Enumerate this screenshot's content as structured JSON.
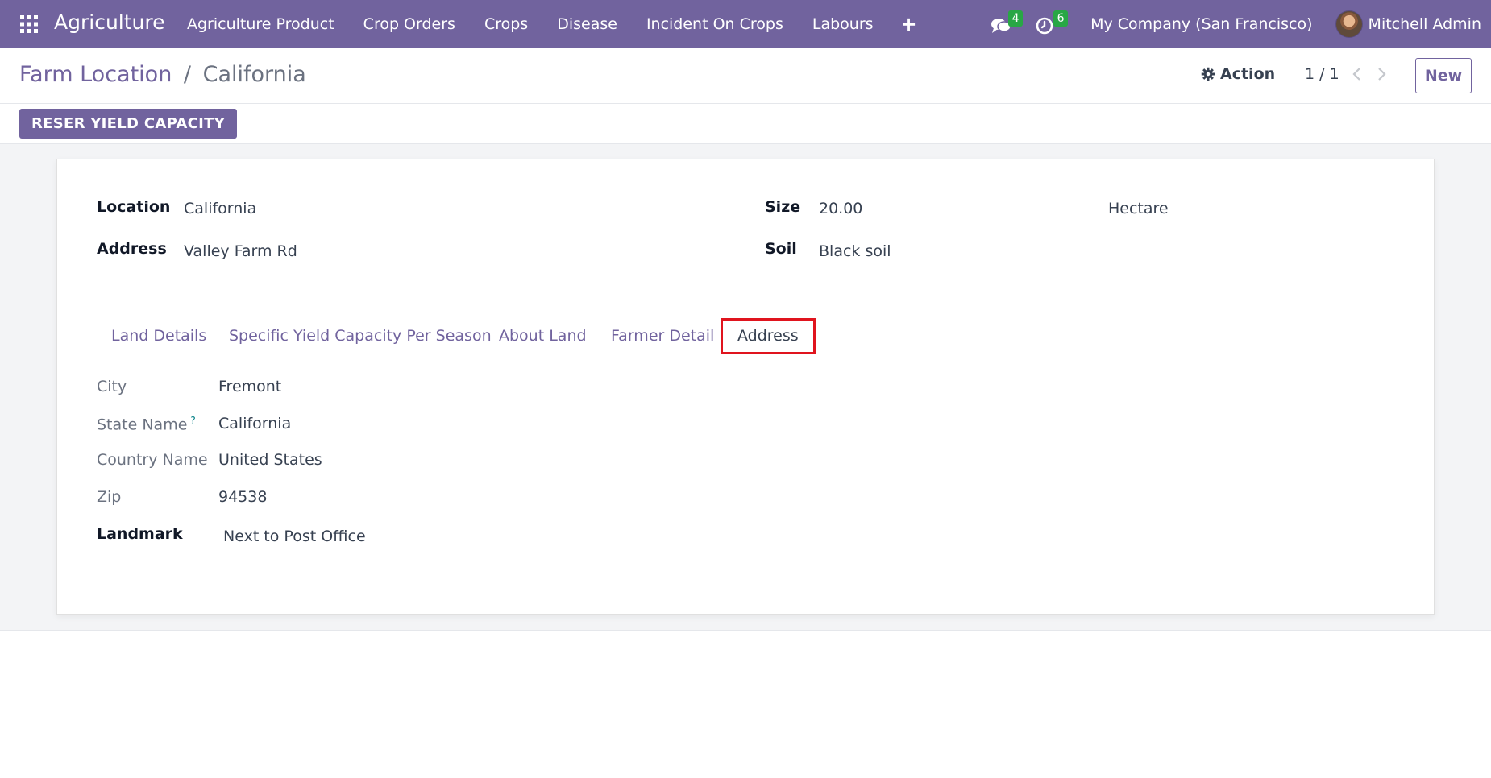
{
  "navbar": {
    "app_name": "Agriculture",
    "menu": [
      "Agriculture Product",
      "Crop Orders",
      "Crops",
      "Disease",
      "Incident On Crops",
      "Labours"
    ],
    "plus_label": "+",
    "messages_count": "4",
    "activities_count": "6",
    "company": "My Company (San Francisco)",
    "user": "Mitchell Admin",
    "icons": [
      "apps-grid-icon",
      "chat-icon",
      "clock-icon",
      "plus-icon"
    ],
    "colors": {
      "brand": "#71639e",
      "badge": "#28a745"
    }
  },
  "control_panel": {
    "breadcrumb_parent": "Farm Location",
    "breadcrumb_sep": "/",
    "breadcrumb_current": "California",
    "action_label": "Action",
    "pager": "1 / 1",
    "new_label": "New"
  },
  "statusbar": {
    "primary_button": "RESER YIELD CAPACITY"
  },
  "form": {
    "location_label": "Location",
    "location_value": "California",
    "address_label": "Address",
    "address_value": "Valley Farm Rd",
    "size_label": "Size",
    "size_value": "20.00",
    "size_unit": "Hectare",
    "soil_label": "Soil",
    "soil_value": "Black soil"
  },
  "tabs": {
    "items": [
      "Land Details",
      "Specific Yield Capacity Per Season",
      "About Land",
      "Farmer Detail",
      "Address"
    ],
    "active": "Address",
    "highlight_color": "#e0141e"
  },
  "address_tab": {
    "city_label": "City",
    "city_value": "Fremont",
    "state_label": "State Name",
    "state_tooltip": "?",
    "state_value": "California",
    "country_label": "Country Name",
    "country_value": "United States",
    "zip_label": "Zip",
    "zip_value": "94538",
    "landmark_label": "Landmark",
    "landmark_value": "Next to Post Office"
  }
}
